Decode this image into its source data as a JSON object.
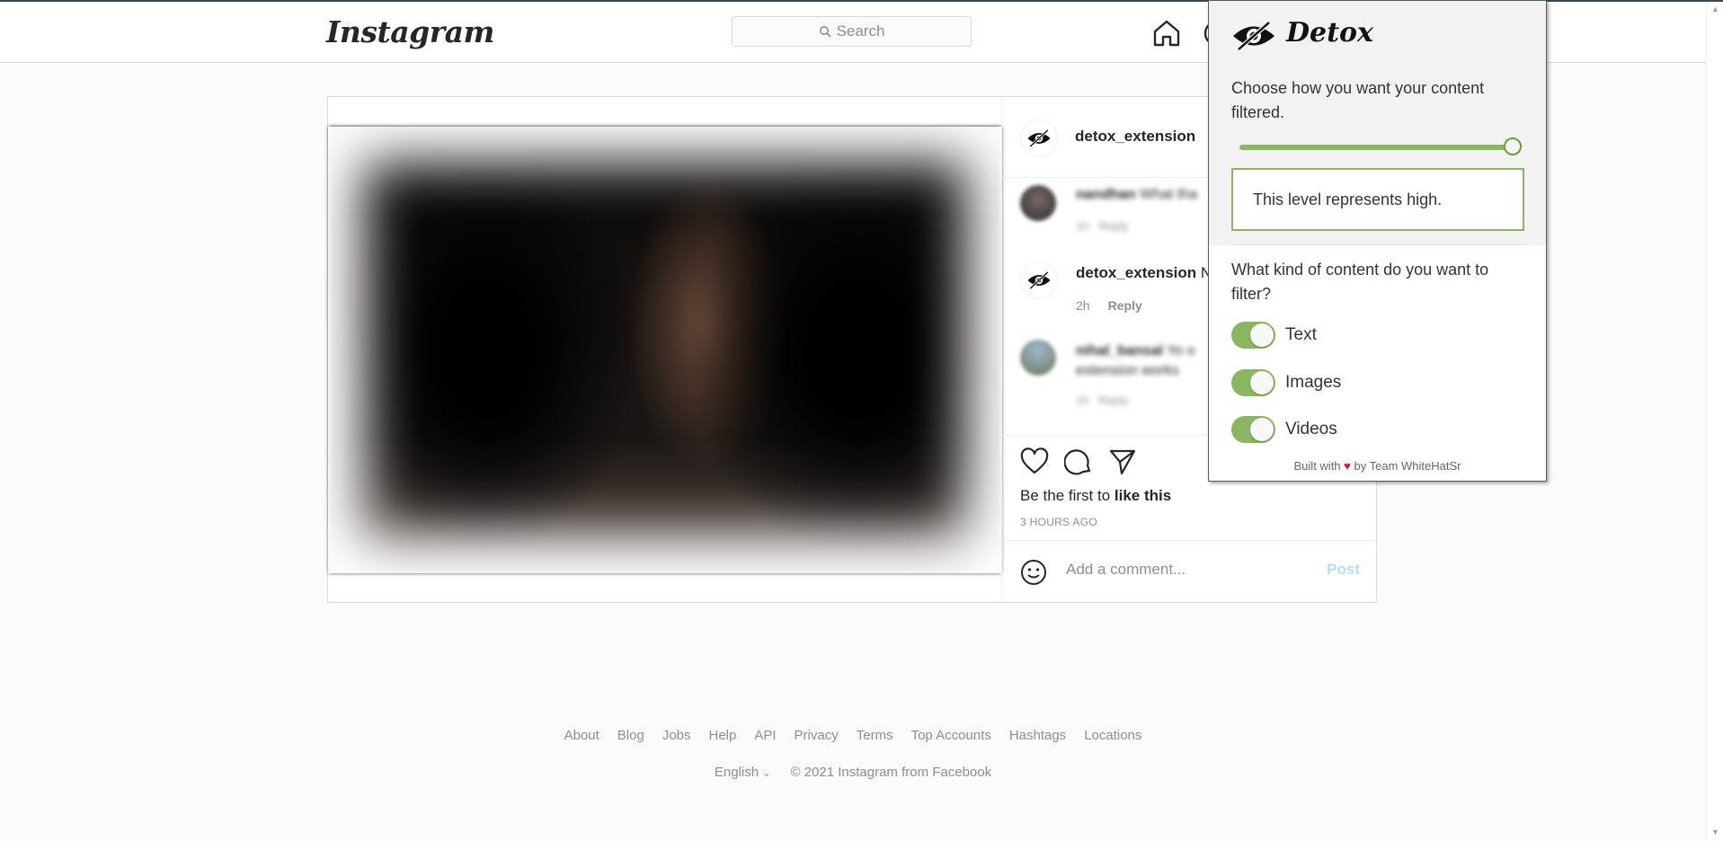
{
  "header": {
    "logo": "Instagram",
    "search_placeholder": "Search"
  },
  "post": {
    "author": "detox_extension",
    "comments": [
      {
        "user": "nandhan",
        "text": "What tha",
        "meta_time": "1h",
        "meta_reply": "Reply",
        "blurred": true
      },
      {
        "user": "detox_extension",
        "text": "N",
        "meta_time": "2h",
        "meta_reply": "Reply",
        "blurred": false
      },
      {
        "user": "nihal_bansal",
        "text": "Yo o extension works",
        "meta_time": "1h",
        "meta_reply": "Reply",
        "blurred": true
      }
    ],
    "likes_prefix": "Be the first to ",
    "likes_link": "like this",
    "timestamp": "3 HOURS AGO",
    "comment_placeholder": "Add a comment...",
    "post_button": "Post"
  },
  "footer": {
    "links": [
      "About",
      "Blog",
      "Jobs",
      "Help",
      "API",
      "Privacy",
      "Terms",
      "Top Accounts",
      "Hashtags",
      "Locations"
    ],
    "language": "English",
    "copyright": "© 2021 Instagram from Facebook"
  },
  "detox": {
    "title": "Detox",
    "filter_question": "Choose how you want your content filtered.",
    "slider_level": 1.0,
    "level_text": "This level represents high.",
    "content_question": "What kind of content do you want to filter?",
    "toggles": [
      {
        "label": "Text",
        "on": true
      },
      {
        "label": "Images",
        "on": true
      },
      {
        "label": "Videos",
        "on": true
      }
    ],
    "footer_prefix": "Built with",
    "footer_heart": "♥",
    "footer_suffix": "by Team WhiteHatSr",
    "accent_color": "#8bb661"
  }
}
